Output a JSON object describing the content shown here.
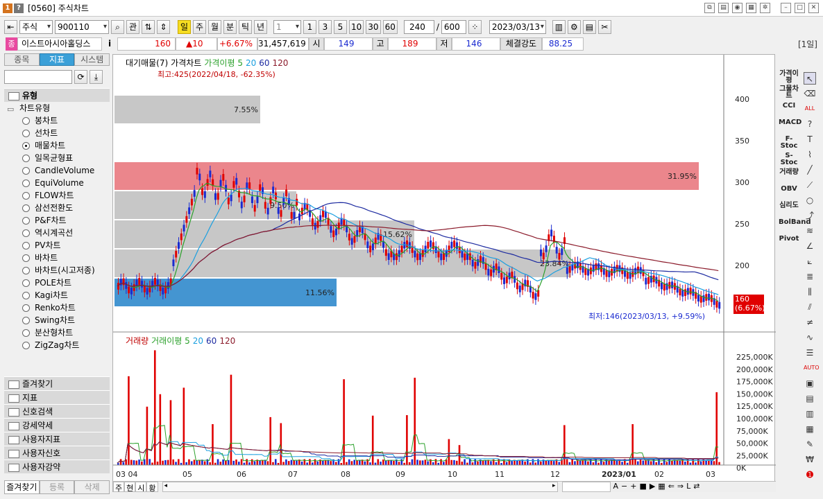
{
  "window": {
    "title": "[0560] 주식차트",
    "badge1": "1",
    "badge2": "?"
  },
  "toolbar": {
    "market": "주식",
    "code": "900110",
    "btn_gwan": "관",
    "periods": [
      "일",
      "주",
      "월",
      "분",
      "틱",
      "년"
    ],
    "interval": "1",
    "quick": [
      "1",
      "3",
      "5",
      "10",
      "30",
      "60"
    ],
    "count": "240",
    "total": "600",
    "date": "2023/03/13"
  },
  "quote": {
    "badge": "종",
    "name": "이스트아시아홀딩스",
    "info": "i",
    "price": "160",
    "change": "▲10",
    "rate": "+6.67%",
    "volume": "31,457,619",
    "open_label": "시",
    "open": "149",
    "high_label": "고",
    "high": "189",
    "low_label": "저",
    "low": "146",
    "strength_label": "체결강도",
    "strength": "88.25",
    "period_badge": "[1일]"
  },
  "left": {
    "tabs": [
      "종목",
      "지표",
      "시스템"
    ],
    "section_type": "유형",
    "tree_root": "차트유형",
    "types": [
      "봉차트",
      "선차트",
      "매물차트",
      "일목균형표",
      "CandleVolume",
      "EquiVolume",
      "FLOW차트",
      "삼선전환도",
      "P&F차트",
      "역시계곡선",
      "PV차트",
      "바차트",
      "바차트(시고저종)",
      "POLE차트",
      "Kagi차트",
      "Renko차트",
      "Swing차트",
      "분산형차트",
      "ZigZag차트"
    ],
    "selected_index": 2,
    "sections": [
      "즐겨찾기",
      "지표",
      "신호검색",
      "강세약세",
      "사용자지표",
      "사용자신호",
      "사용자강약"
    ],
    "bottom_tabs": [
      "즐겨찾기",
      "등록",
      "삭제"
    ]
  },
  "chart": {
    "price_legend": [
      "대기매물(7)",
      "가격차트",
      "가격이평 5",
      "20",
      "60",
      "120"
    ],
    "volume_legend": [
      "거래량",
      "거래이평 5",
      "20",
      "60",
      "120"
    ],
    "max_label": "최고:425(2022/04/18, -62.35%)",
    "min_label": "최저:146(2023/03/13, +9.59%)",
    "current_price": "160",
    "current_rate": "(6.67%)",
    "price_ticks": [
      "400",
      "350",
      "300",
      "250",
      "200"
    ],
    "volume_ticks": [
      "225,000K",
      "200,000K",
      "175,000K",
      "150,000K",
      "125,000K",
      "100,000K",
      "75,000K",
      "50,000K",
      "25,000K",
      "0K"
    ],
    "x_labels": [
      "03 04",
      "05",
      "06",
      "07",
      "08",
      "09",
      "10",
      "11",
      "12",
      "2023/01",
      "02",
      "03"
    ],
    "profile_pct": [
      "7.55%",
      "31.95%",
      "9.50%",
      "15.62%",
      "23.84%",
      "11.56%"
    ],
    "bottom_tabs": [
      "주",
      "현",
      "시",
      "황"
    ],
    "colors": {
      "ma5": "#2aa02a",
      "ma20": "#1a9fe0",
      "ma60": "#1c2aa0",
      "ma120": "#8b1a2a",
      "up": "#e00000",
      "down": "#1a2ad0",
      "highlight": "#e0454f",
      "current": "#3a8fcf"
    }
  },
  "right_tools": [
    "가격이평",
    "그물차트",
    "CCI",
    "MACD",
    "F-Stoc",
    "S-Stoc",
    "거래량",
    "OBV",
    "심리도",
    "BolBand",
    "Pivot"
  ]
}
